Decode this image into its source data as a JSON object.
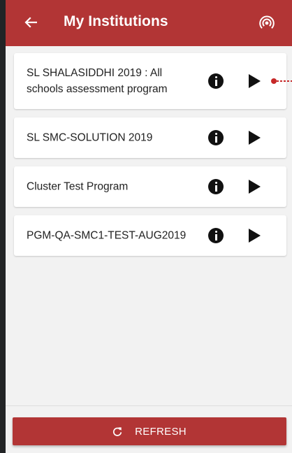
{
  "header": {
    "title": "My Institutions",
    "back_icon": "arrow-left-icon",
    "action_icon": "broadcast-icon",
    "color": "#b23535"
  },
  "programs": [
    {
      "name": "SL SHALASIDDHI 2019 : All schools assessment program",
      "info_icon": "info-icon",
      "open_icon": "play-icon"
    },
    {
      "name": "SL SMC-SOLUTION 2019",
      "info_icon": "info-icon",
      "open_icon": "play-icon"
    },
    {
      "name": "Cluster Test Program",
      "info_icon": "info-icon",
      "open_icon": "play-icon"
    },
    {
      "name": "PGM-QA-SMC1-TEST-AUG2019",
      "info_icon": "info-icon",
      "open_icon": "play-icon"
    }
  ],
  "footer": {
    "refresh_label": "REFRESH",
    "refresh_icon": "refresh-icon",
    "color": "#b23535"
  }
}
